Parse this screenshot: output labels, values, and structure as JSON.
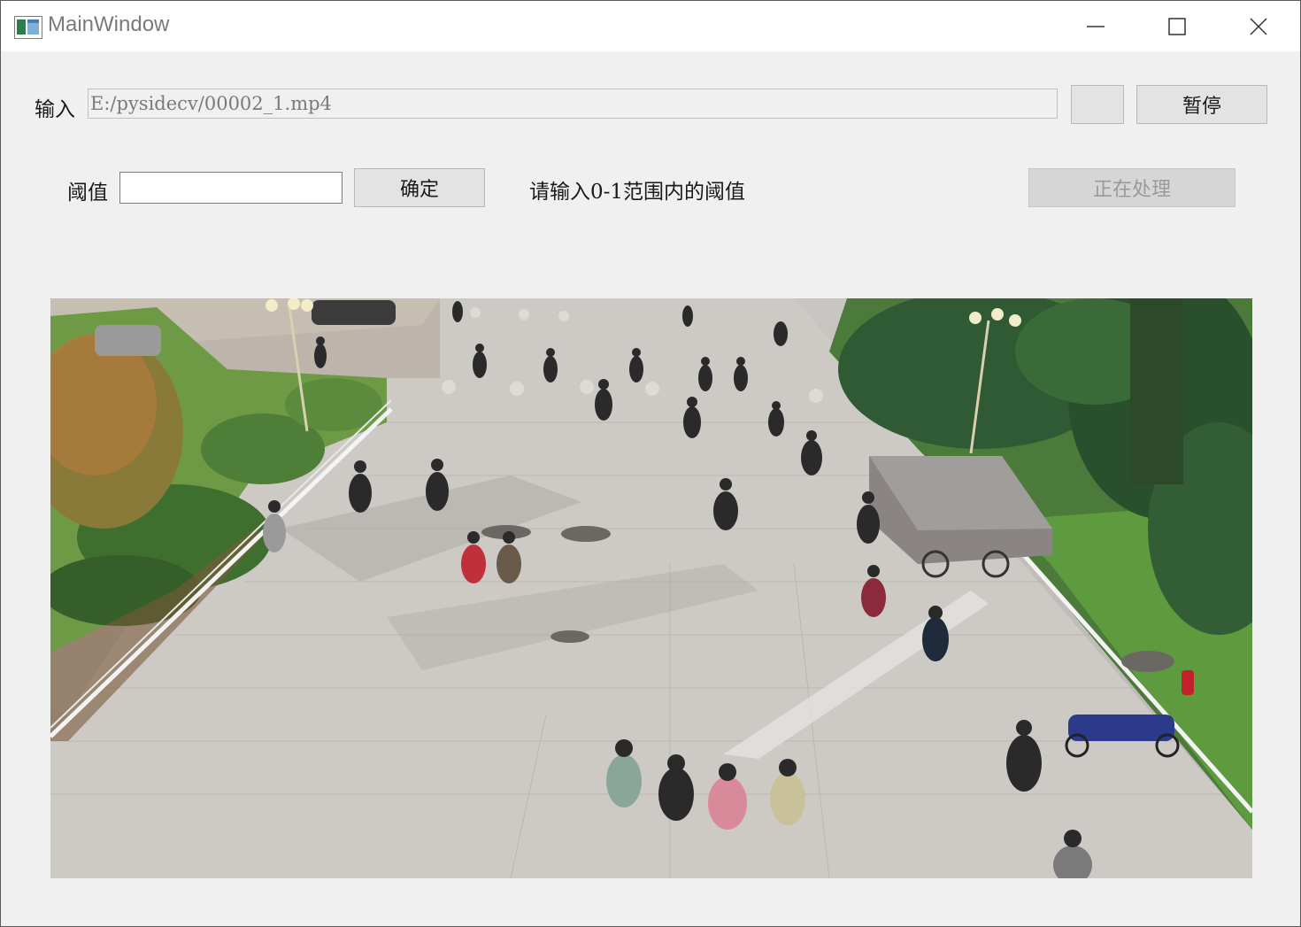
{
  "window": {
    "title": "MainWindow",
    "controls": [
      "minimize-icon",
      "maximize-icon",
      "close-icon"
    ]
  },
  "input_row": {
    "label": "输入",
    "path_value": "E:/pysidecv/00002_1.mp4",
    "browse_label": "",
    "pause_label": "暂停"
  },
  "threshold_row": {
    "label": "阈值",
    "input_value": "",
    "confirm_label": "确定",
    "hint": "请输入0-1范围内的阈值",
    "status_label": "正在处理"
  },
  "video": {
    "description_icon": "video-frame"
  },
  "colors": {
    "window_bg": "#f0f0f0",
    "titlebar_bg": "#ffffff",
    "button_bg": "#e3e3e3",
    "disabled_text": "#9a9a9a"
  }
}
